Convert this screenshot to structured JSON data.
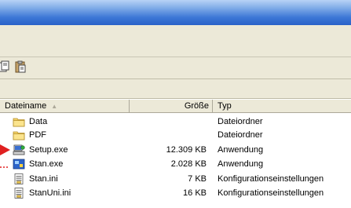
{
  "columns": {
    "name": "Dateiname",
    "size": "Größe",
    "type": "Typ"
  },
  "files": [
    {
      "name": "Data",
      "size": "",
      "type": "Dateiordner",
      "icon": "folder-icon"
    },
    {
      "name": "PDF",
      "size": "",
      "type": "Dateiordner",
      "icon": "folder-icon"
    },
    {
      "name": "Setup.exe",
      "size": "12.309 KB",
      "type": "Anwendung",
      "icon": "setup-exe-icon"
    },
    {
      "name": "Stan.exe",
      "size": "2.028 KB",
      "type": "Anwendung",
      "icon": "app-exe-icon"
    },
    {
      "name": "Stan.ini",
      "size": "7 KB",
      "type": "Konfigurationseinstellungen",
      "icon": "ini-file-icon"
    },
    {
      "name": "StanUni.ini",
      "size": "16 KB",
      "type": "Konfigurationseinstellungen",
      "icon": "ini-file-icon"
    }
  ],
  "colors": {
    "titlebar": "#3c76d6",
    "chrome": "#ece9d8",
    "folder": "#f5d46a",
    "pointer_red": "#e02020"
  }
}
